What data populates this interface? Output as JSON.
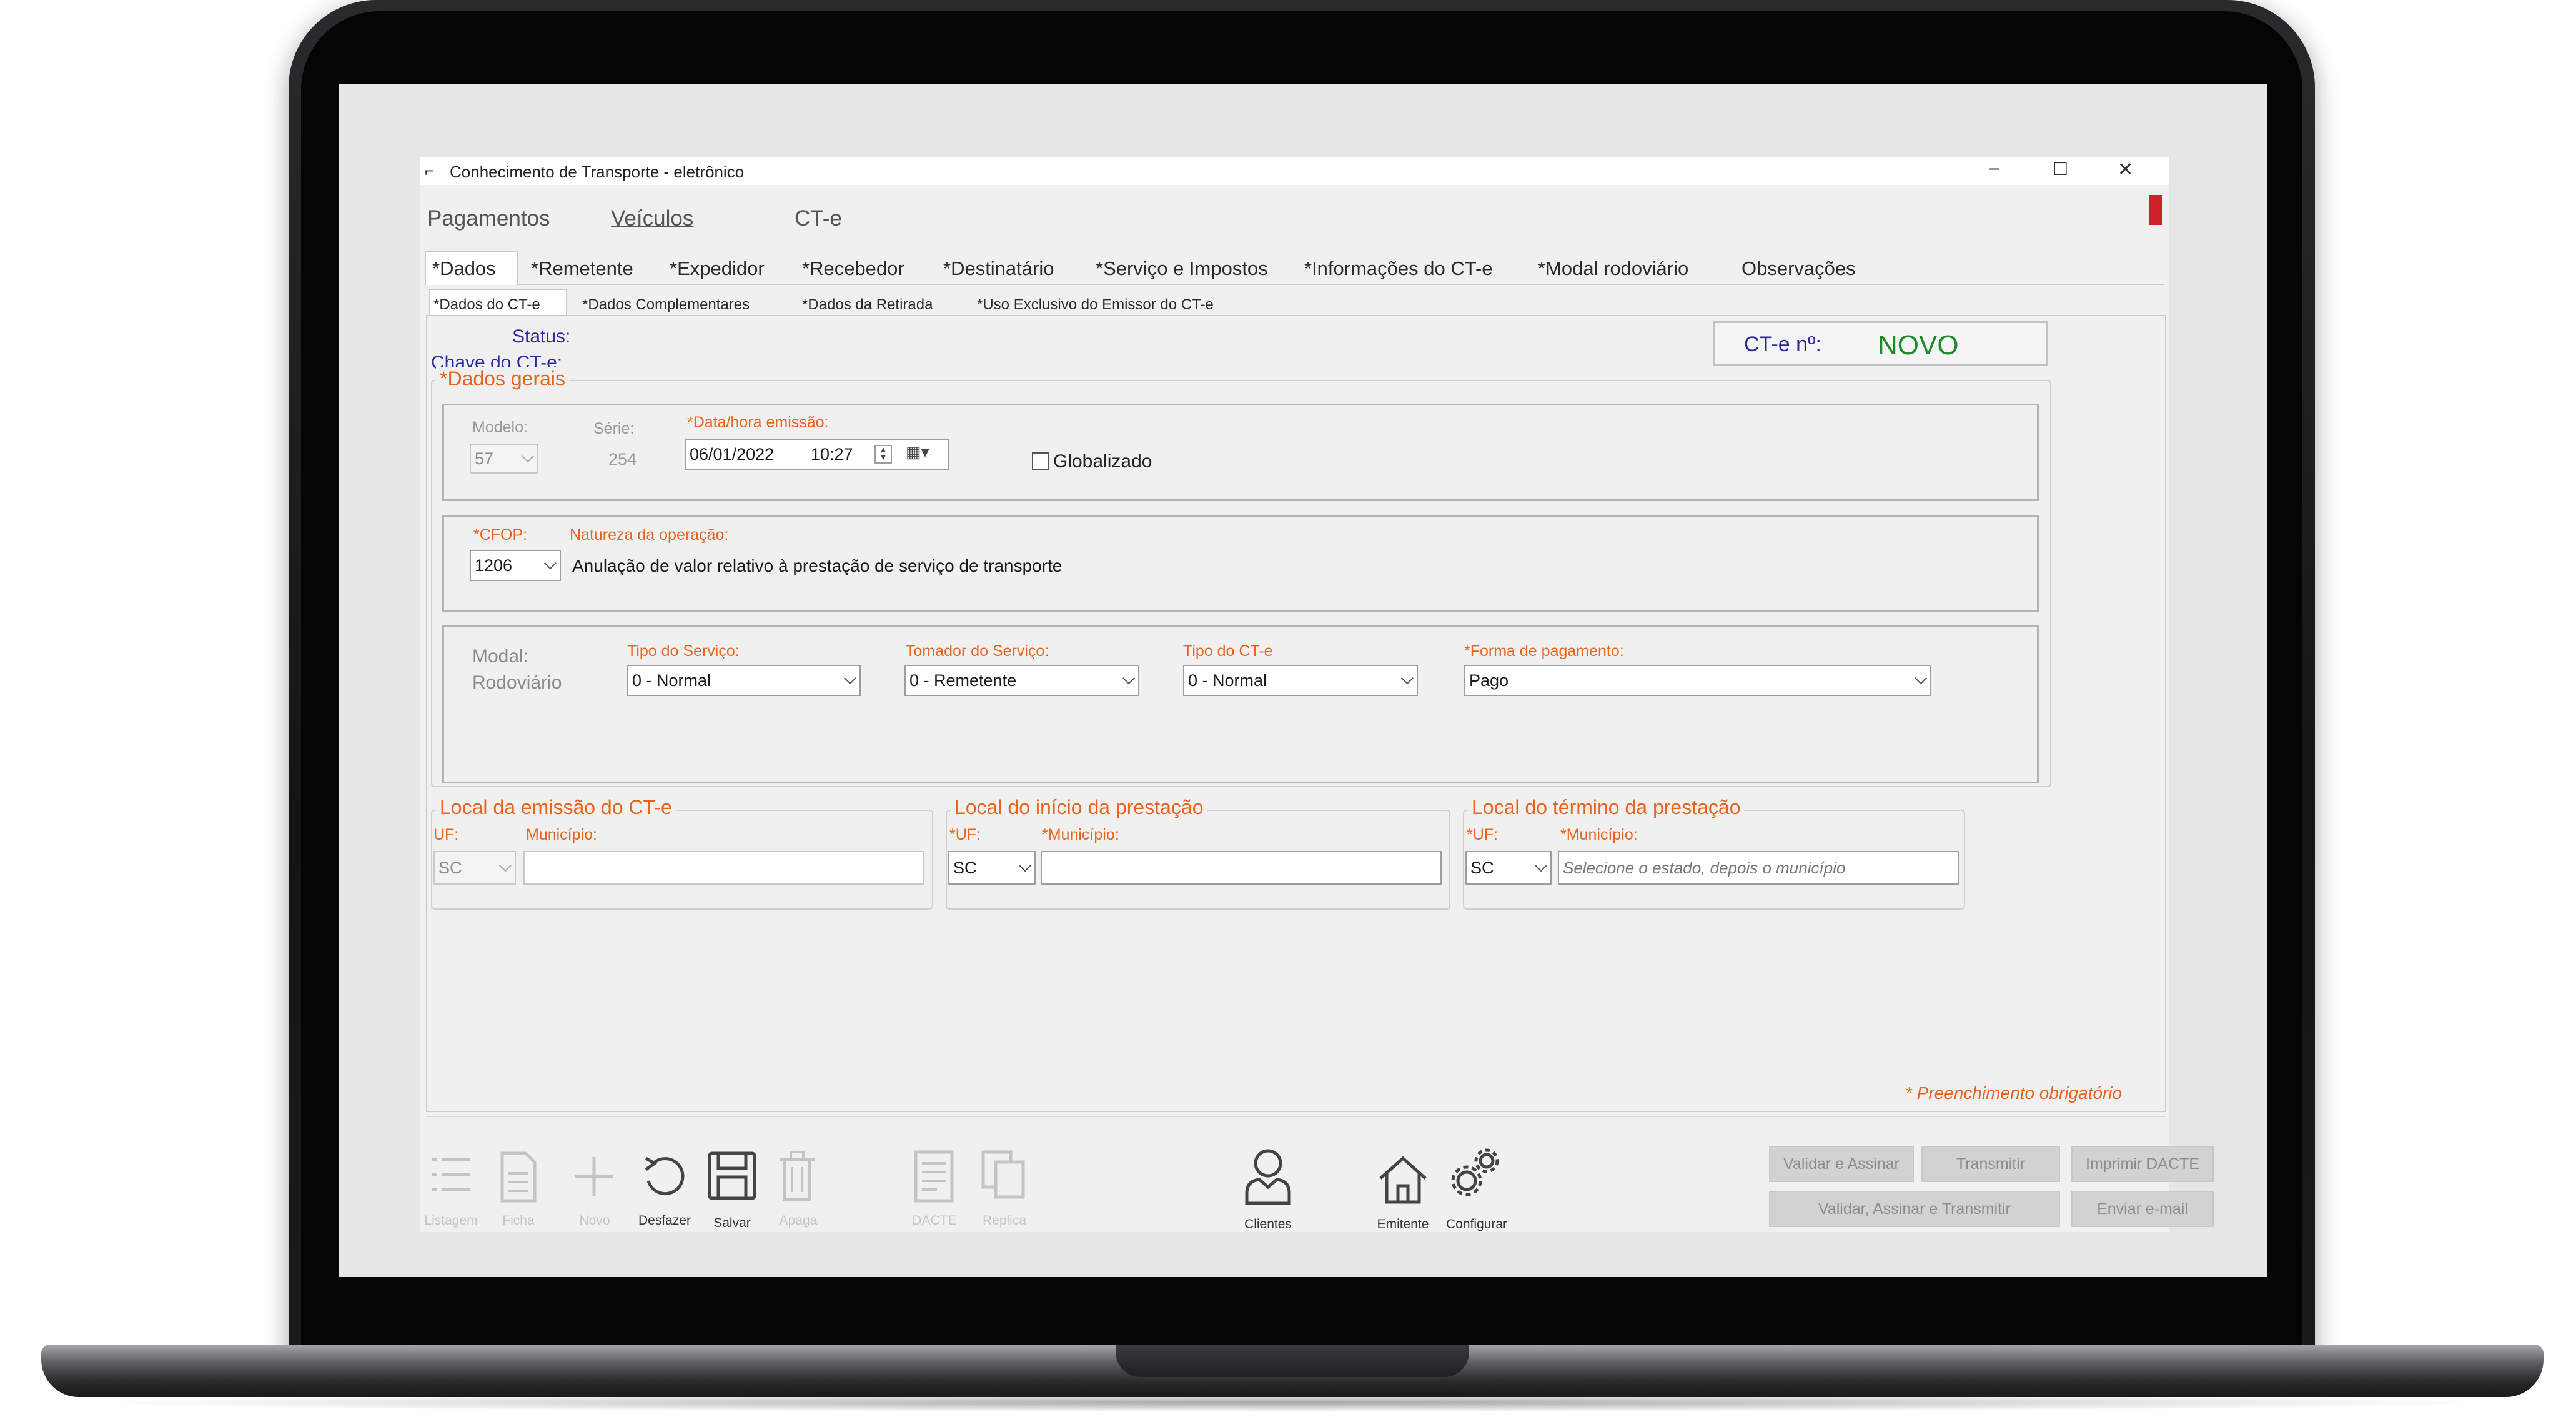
{
  "window": {
    "title": "Conhecimento de Transporte - eletrônico",
    "controls": {
      "minimize": "–",
      "maximize": "☐",
      "close": "✕"
    }
  },
  "menu": [
    {
      "label": "Pagamentos"
    },
    {
      "label": "Veículos"
    },
    {
      "label": "CT-e"
    }
  ],
  "tabs": [
    {
      "label": "*Dados",
      "active": true
    },
    {
      "label": "*Remetente"
    },
    {
      "label": "*Expedidor"
    },
    {
      "label": "*Recebedor"
    },
    {
      "label": "*Destinatário"
    },
    {
      "label": "*Serviço e Impostos"
    },
    {
      "label": "*Informações do CT-e"
    },
    {
      "label": "*Modal rodoviário"
    },
    {
      "label": "Observações"
    }
  ],
  "subtabs": [
    {
      "label": "*Dados do CT-e",
      "active": true
    },
    {
      "label": "*Dados Complementares"
    },
    {
      "label": "*Dados da Retirada"
    },
    {
      "label": "*Uso Exclusivo do Emissor do CT-e"
    }
  ],
  "status": {
    "status_label": "Status:",
    "chave_label": "Chave do CT-e:"
  },
  "cte_number": {
    "label": "CT-e nº:",
    "value": "NOVO",
    "value_color": "#1f8a2a"
  },
  "dados_gerais": {
    "legend": "*Dados gerais",
    "modelo_label": "Modelo:",
    "modelo_value": "57",
    "serie_label": "Série:",
    "serie_value": "254",
    "data_label": "*Data/hora emissão:",
    "data_value": "06/01/2022",
    "hora_value": "10:27",
    "globalizado_label": "Globalizado",
    "globalizado_checked": false
  },
  "cfop": {
    "cfop_label": "*CFOP:",
    "natureza_label": "Natureza da operação:",
    "cfop_value": "1206",
    "natureza_value": "Anulação de valor relativo à prestação de serviço de transporte"
  },
  "servico": {
    "modal_label": "Modal:",
    "modal_value": "Rodoviário",
    "tipo_servico_label": "Tipo do Serviço:",
    "tipo_servico_value": "0 - Normal",
    "tomador_label": "Tomador do Serviço:",
    "tomador_value": "0 - Remetente",
    "tipo_cte_label": "Tipo do CT-e",
    "tipo_cte_value": "0 - Normal",
    "forma_pag_label": "*Forma de pagamento:",
    "forma_pag_value": "Pago"
  },
  "locais": [
    {
      "legend": "Local da emissão do CT-e",
      "uf_label": "UF:",
      "uf_value": "SC",
      "mun_label": "Município:",
      "mun_value": "",
      "mun_placeholder": ""
    },
    {
      "legend": "Local do início da prestação",
      "uf_label": "*UF:",
      "uf_value": "SC",
      "mun_label": "*Município:",
      "mun_value": "",
      "mun_placeholder": ""
    },
    {
      "legend": "Local do término da prestação",
      "uf_label": "*UF:",
      "uf_value": "SC",
      "mun_label": "*Município:",
      "mun_value": "",
      "mun_placeholder": "Selecione o estado, depois o município"
    }
  ],
  "required_note": "* Preenchimento obrigatório",
  "toolbar": [
    {
      "label": "Listagem",
      "icon": "list-icon",
      "enabled": false
    },
    {
      "label": "Ficha",
      "icon": "document-icon",
      "enabled": false
    },
    {
      "label": "Novo",
      "icon": "plus-icon",
      "enabled": false
    },
    {
      "label": "Desfazer",
      "icon": "undo-icon",
      "enabled": true
    },
    {
      "label": "Salvar",
      "icon": "save-icon",
      "enabled": true
    },
    {
      "label": "Apaga",
      "icon": "trash-icon",
      "enabled": false
    },
    {
      "label": "DACTE",
      "icon": "dacte-icon",
      "enabled": false
    },
    {
      "label": "Replica",
      "icon": "copy-icon",
      "enabled": false
    },
    {
      "label": "Clientes",
      "icon": "person-icon",
      "enabled": true
    },
    {
      "label": "Emitente",
      "icon": "home-icon",
      "enabled": true
    },
    {
      "label": "Configurar",
      "icon": "gears-icon",
      "enabled": true
    }
  ],
  "actions": {
    "validar_assinar": "Validar e Assinar",
    "transmitir": "Transmitir",
    "imprimir": "Imprimir DACTE",
    "validar_assinar_transmitir": "Validar, Assinar e Transmitir",
    "enviar_email": "Enviar e-mail"
  },
  "colors": {
    "required_label": "#e8641c",
    "accent_blue": "#2a2a9a",
    "required_marker": "#d0202a"
  }
}
